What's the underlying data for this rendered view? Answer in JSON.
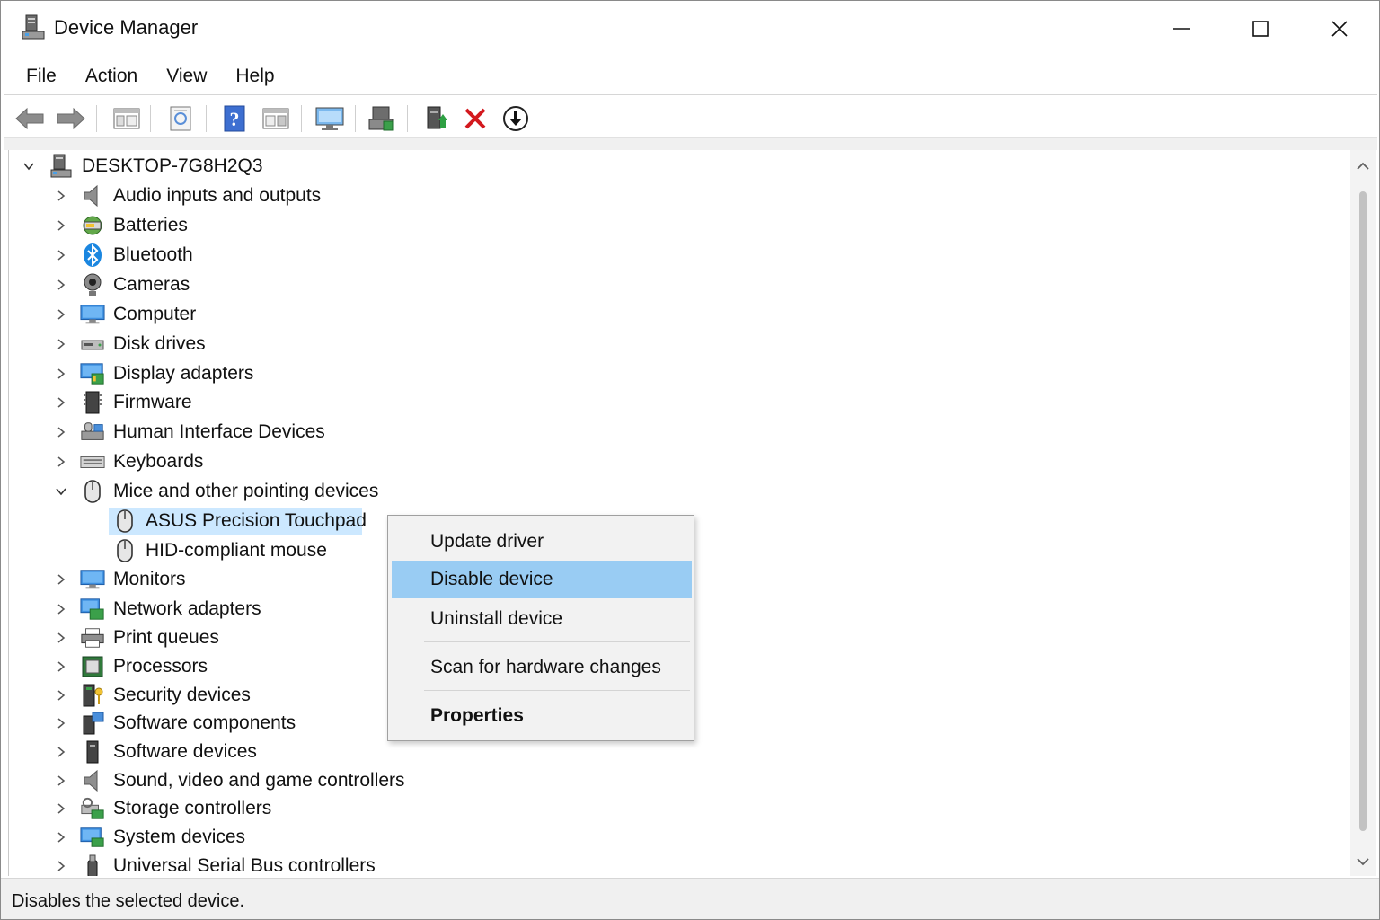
{
  "window": {
    "title": "Device Manager",
    "controls": {
      "minimize": "minimize-icon",
      "maximize": "maximize-icon",
      "close": "close-icon"
    }
  },
  "menu": [
    "File",
    "Action",
    "View",
    "Help"
  ],
  "toolbar": {
    "icons": [
      "back-arrow-icon",
      "forward-arrow-icon",
      "show-hide-console-tree-icon",
      "properties-sheet-icon",
      "help-icon",
      "action-pane-icon",
      "monitor-scan-icon",
      "update-driver-icon",
      "enable-device-icon",
      "uninstall-x-icon",
      "download-driver-icon"
    ]
  },
  "tree": {
    "root": {
      "label": "DESKTOP-7G8H2Q3",
      "expanded": true,
      "icon": "computer-tower-icon"
    },
    "categories": [
      {
        "label": "Audio inputs and outputs",
        "icon": "speaker-icon"
      },
      {
        "label": "Batteries",
        "icon": "battery-icon"
      },
      {
        "label": "Bluetooth",
        "icon": "bluetooth-icon"
      },
      {
        "label": "Cameras",
        "icon": "webcam-icon"
      },
      {
        "label": "Computer",
        "icon": "monitor-icon"
      },
      {
        "label": "Disk drives",
        "icon": "disk-drive-icon"
      },
      {
        "label": "Display adapters",
        "icon": "display-adapter-icon"
      },
      {
        "label": "Firmware",
        "icon": "firmware-icon"
      },
      {
        "label": "Human Interface Devices",
        "icon": "hid-icon"
      },
      {
        "label": "Keyboards",
        "icon": "keyboard-icon"
      },
      {
        "label": "Mice and other pointing devices",
        "icon": "mouse-icon",
        "expanded": true,
        "children": [
          {
            "label": "ASUS Precision Touchpad",
            "icon": "mouse-icon",
            "selected": true
          },
          {
            "label": "HID-compliant mouse",
            "icon": "mouse-icon"
          }
        ]
      },
      {
        "label": "Monitors",
        "icon": "monitor-icon"
      },
      {
        "label": "Network adapters",
        "icon": "network-adapter-icon"
      },
      {
        "label": "Print queues",
        "icon": "printer-icon"
      },
      {
        "label": "Processors",
        "icon": "processor-icon"
      },
      {
        "label": "Security devices",
        "icon": "security-device-icon"
      },
      {
        "label": "Software components",
        "icon": "software-component-icon"
      },
      {
        "label": "Software devices",
        "icon": "software-device-icon"
      },
      {
        "label": "Sound, video and game controllers",
        "icon": "speaker-icon"
      },
      {
        "label": "Storage controllers",
        "icon": "storage-controller-icon"
      },
      {
        "label": "System devices",
        "icon": "system-devices-icon"
      },
      {
        "label": "Universal Serial Bus controllers",
        "icon": "usb-icon"
      }
    ]
  },
  "context_menu": {
    "items": [
      {
        "label": "Update driver"
      },
      {
        "label": "Disable device",
        "highlighted": true
      },
      {
        "label": "Uninstall device"
      },
      {
        "label": "Scan for hardware changes"
      },
      {
        "label": "Properties",
        "bold": true
      }
    ]
  },
  "status": {
    "text": "Disables the selected device."
  },
  "colors": {
    "selection": "#cce8ff",
    "menu_highlight": "#99ccf3",
    "status_bar": "#f0f0f0"
  }
}
